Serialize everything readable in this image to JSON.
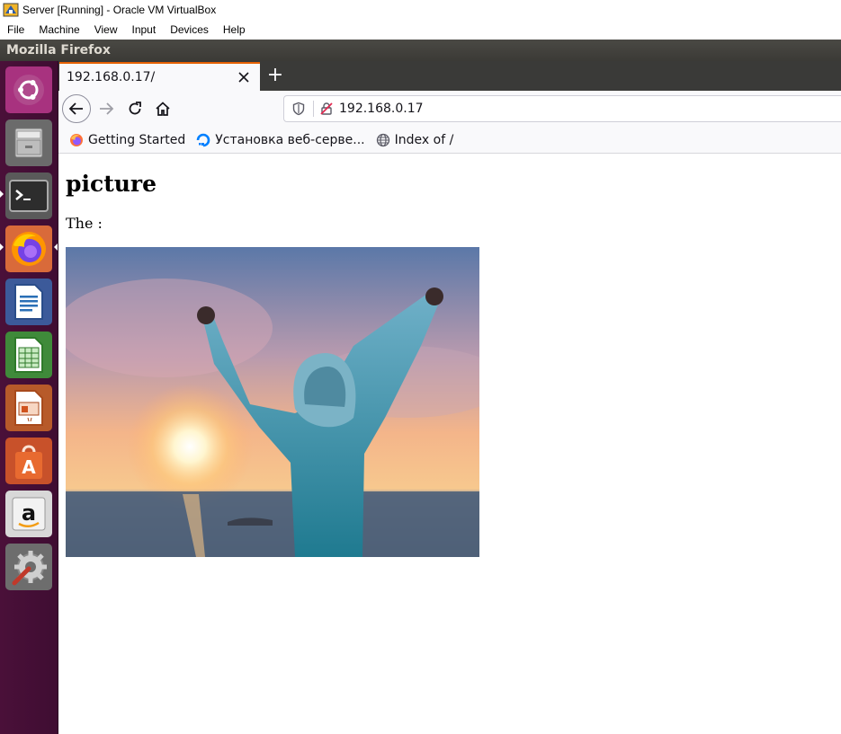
{
  "vbox": {
    "title": "Server [Running] - Oracle VM VirtualBox",
    "menu": [
      "File",
      "Machine",
      "View",
      "Input",
      "Devices",
      "Help"
    ]
  },
  "ubuntu": {
    "topbar_title": "Mozilla Firefox",
    "launcher": [
      {
        "name": "ubuntu-dash-icon"
      },
      {
        "name": "files-icon"
      },
      {
        "name": "terminal-icon"
      },
      {
        "name": "firefox-icon"
      },
      {
        "name": "libreoffice-writer-icon"
      },
      {
        "name": "libreoffice-calc-icon"
      },
      {
        "name": "libreoffice-impress-icon"
      },
      {
        "name": "software-center-icon"
      },
      {
        "name": "amazon-icon"
      },
      {
        "name": "system-settings-icon"
      }
    ]
  },
  "firefox": {
    "tab": {
      "title": "192.168.0.17/"
    },
    "new_tab_symbol": "+",
    "url": "192.168.0.17",
    "bookmarks": [
      {
        "label": "Getting Started",
        "icon": "firefox-small-icon"
      },
      {
        "label": "Установка веб-серве...",
        "icon": "digitalocean-icon"
      },
      {
        "label": "Index of /",
        "icon": "globe-icon"
      }
    ]
  },
  "page": {
    "heading": "picture",
    "paragraph": "The :",
    "image_alt": "person with raised arms facing sunset over sea"
  },
  "colors": {
    "launcher_bg": "#3f0d32",
    "topbar_bg": "#3b3a36",
    "tab_accent": "#e66000"
  }
}
